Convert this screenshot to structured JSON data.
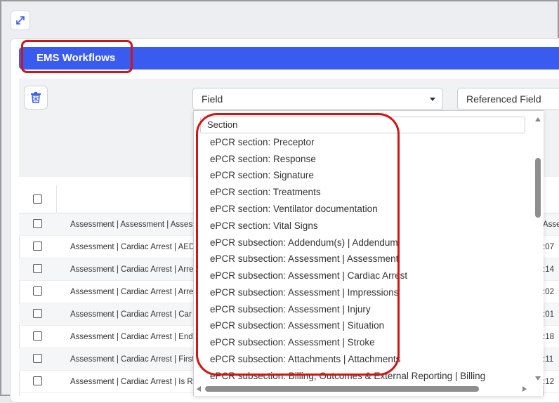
{
  "header": {
    "title": "EMS Workflows"
  },
  "filters": {
    "field_select": "Field",
    "referenced_field_select": "Referenced Field"
  },
  "dropdown": {
    "search_value": "Section",
    "items": [
      "ePCR section: Preceptor",
      "ePCR section: Response",
      "ePCR section: Signature",
      "ePCR section: Treatments",
      "ePCR section: Ventilator documentation",
      "ePCR section: Vital Signs",
      "ePCR subsection: Addendum(s) | Addendum",
      "ePCR subsection: Assessment | Assessment",
      "ePCR subsection: Assessment | Cardiac Arrest",
      "ePCR subsection: Assessment | Impressions",
      "ePCR subsection: Assessment | Injury",
      "ePCR subsection: Assessment | Situation",
      "ePCR subsection: Assessment | Stroke",
      "ePCR subsection: Attachments | Attachments",
      "ePCR subsection: Billing, Outcomes & External Reporting | Billing"
    ]
  },
  "table": {
    "rows": [
      {
        "text": "Assessment | Assessment | Assess",
        "right": "Asse"
      },
      {
        "text": "Assessment | Cardiac Arrest | AED",
        "right": ":07"
      },
      {
        "text": "Assessment | Cardiac Arrest | Arre",
        "right": ":14"
      },
      {
        "text": "Assessment | Cardiac Arrest | Arre",
        "right": ":02"
      },
      {
        "text": "Assessment | Cardiac Arrest | Car",
        "right": ":01"
      },
      {
        "text": "Assessment | Cardiac Arrest | End",
        "right": ":18"
      },
      {
        "text": "Assessment | Cardiac Arrest | First",
        "right": ":11"
      },
      {
        "text": "Assessment | Cardiac Arrest | Is R",
        "right": ":12"
      }
    ]
  },
  "colors": {
    "accent": "#3a5bf0",
    "highlight": "#d21414"
  },
  "icons": {
    "expand": "expand-icon",
    "trash": "trash-icon"
  }
}
